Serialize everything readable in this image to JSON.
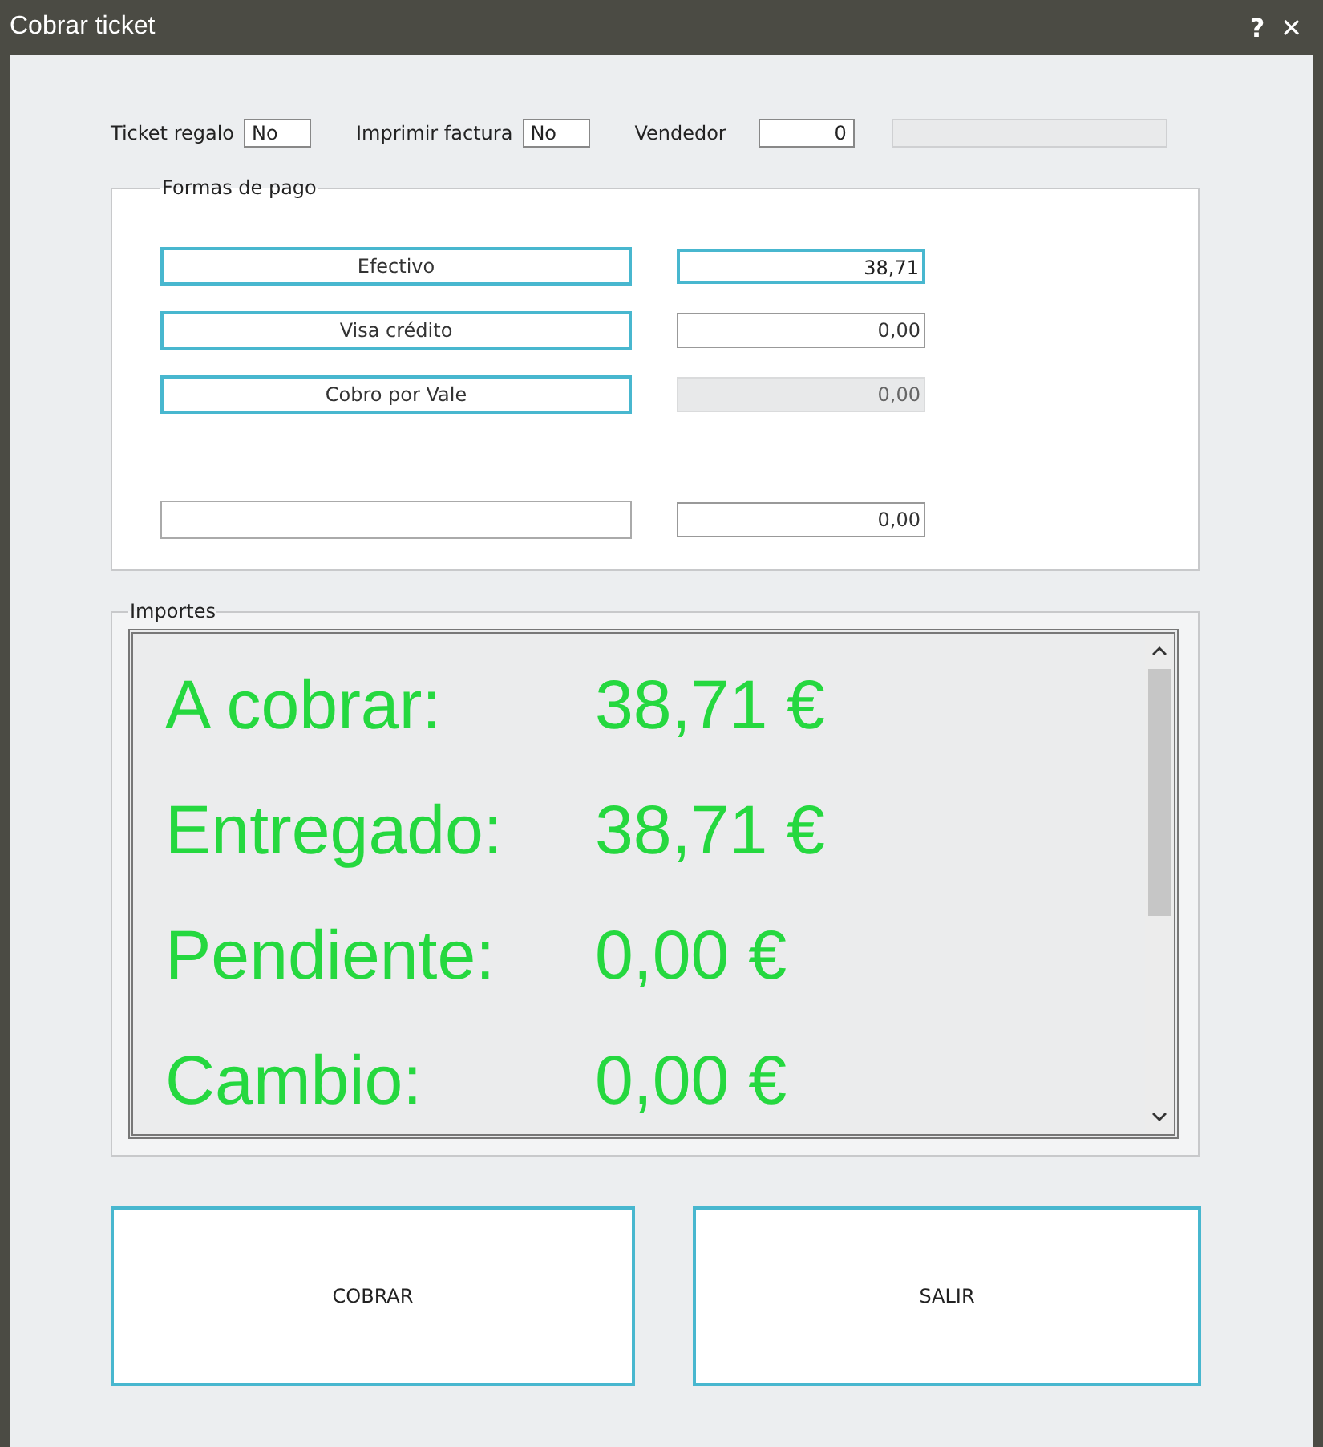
{
  "window": {
    "title": "Cobrar ticket",
    "help": "?",
    "close": "✕"
  },
  "top_fields": [
    {
      "label": "Ticket regalo",
      "value": "No",
      "kind": "short"
    },
    {
      "label": "Imprimir factura",
      "value": "No",
      "kind": "short"
    },
    {
      "label": "Vendedor",
      "value": "0",
      "kind": "number"
    },
    {
      "kind": "readonly"
    }
  ],
  "payments": {
    "title": "Formas de pago",
    "rows": [
      {
        "method": "Efectivo",
        "method_enabled": true,
        "amount": "38,71",
        "focused": true,
        "disabled": false
      },
      {
        "method": "Visa crédito",
        "method_enabled": true,
        "amount": "0,00",
        "focused": false,
        "disabled": false
      },
      {
        "method": "Cobro por Vale",
        "method_enabled": true,
        "amount": "0,00",
        "focused": false,
        "disabled": true
      },
      {
        "kind": "spacer"
      },
      {
        "method_enabled": false,
        "amount": "0,00",
        "focused": false,
        "disabled": false
      }
    ]
  },
  "amounts": {
    "title": "Importes",
    "rows": [
      {
        "label": "A cobrar:",
        "value": "38,71 €"
      },
      {
        "label": "Entregado:",
        "value": "38,71 €"
      },
      {
        "label": "Pendiente:",
        "value": "0,00 €"
      },
      {
        "label": "Cambio:",
        "value": "0,00 €"
      }
    ]
  },
  "buttons": [
    "COBRAR",
    "SALIR"
  ]
}
